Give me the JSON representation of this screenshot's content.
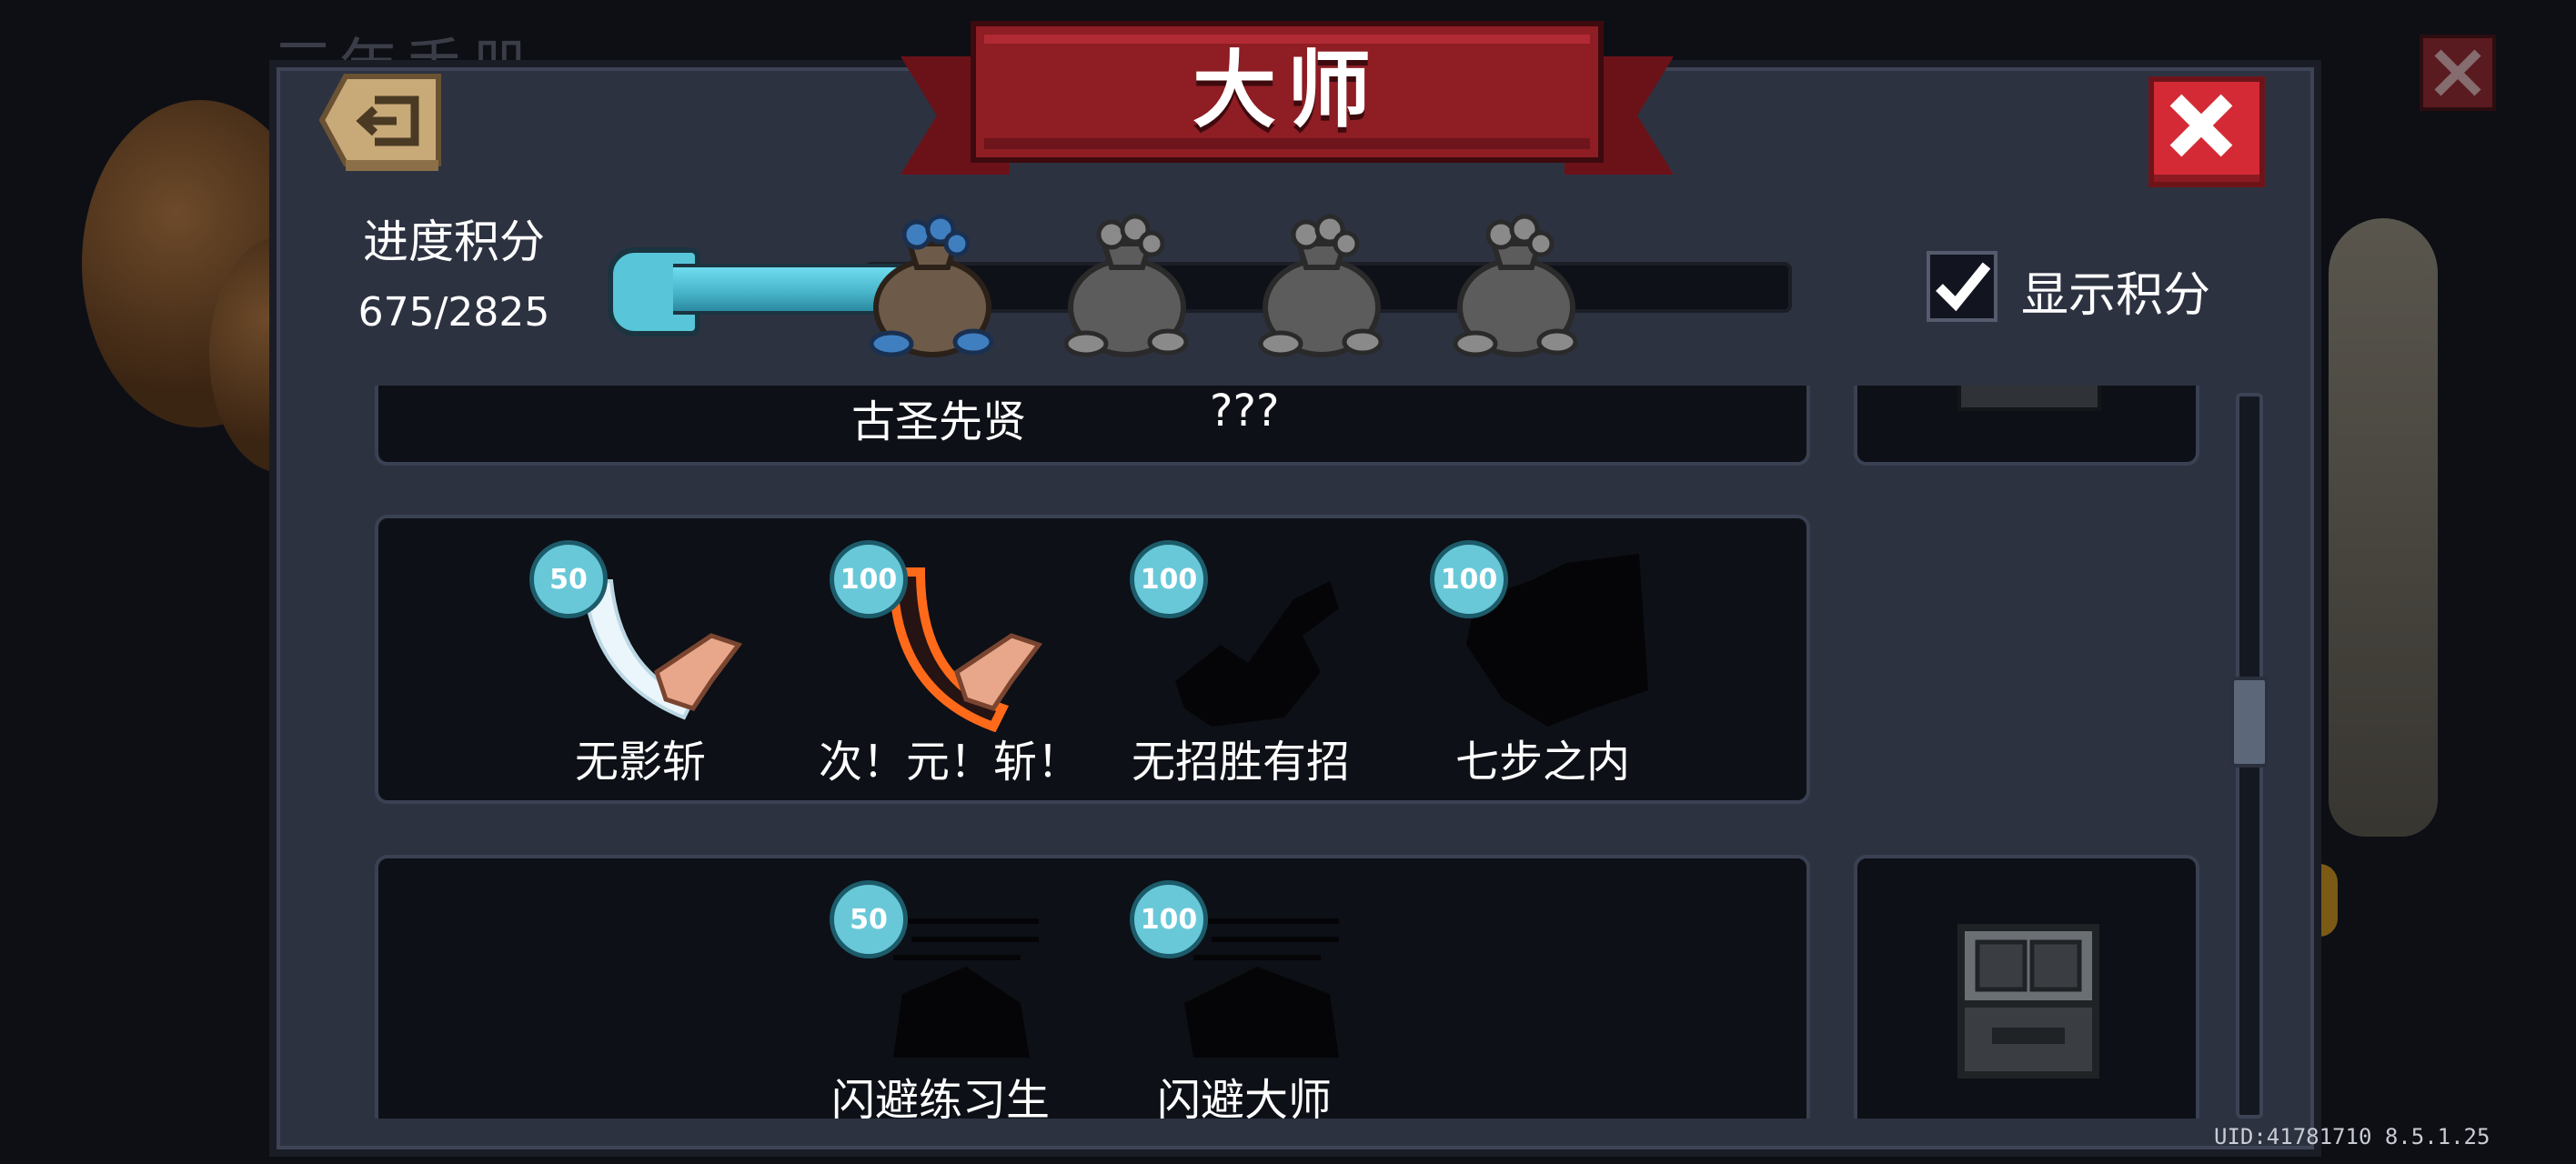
{
  "background": {
    "title_partial": "三年手册"
  },
  "modal": {
    "title": "大师"
  },
  "progress": {
    "label": "进度积分",
    "value_text": "675/2825",
    "current": 675,
    "max": 2825
  },
  "show_score": {
    "label": "显示积分",
    "checked": true
  },
  "row1": {
    "labels": [
      "古圣先贤",
      "???"
    ]
  },
  "row2": {
    "items": [
      {
        "label": "无影斩",
        "points": "50",
        "unlocked": true
      },
      {
        "label": "次！元！斩！",
        "points": "100",
        "unlocked": true
      },
      {
        "label": "无招胜有招",
        "points": "100",
        "unlocked": false
      },
      {
        "label": "七步之内",
        "points": "100",
        "unlocked": false
      }
    ]
  },
  "row3": {
    "items": [
      {
        "label": "闪避练习生",
        "points": "50",
        "unlocked": false
      },
      {
        "label": "闪避大师",
        "points": "100",
        "unlocked": false
      }
    ]
  },
  "footer": {
    "uid": "UID:41781710 8.5.1.25"
  },
  "colors": {
    "accent_cyan": "#58c5d9",
    "banner_red": "#8e1d24",
    "close_red": "#d32a35",
    "panel": "#2d3241"
  },
  "icons": [
    "back-icon",
    "close-icon",
    "checkmark-icon",
    "sack-icon",
    "chest-icon"
  ]
}
